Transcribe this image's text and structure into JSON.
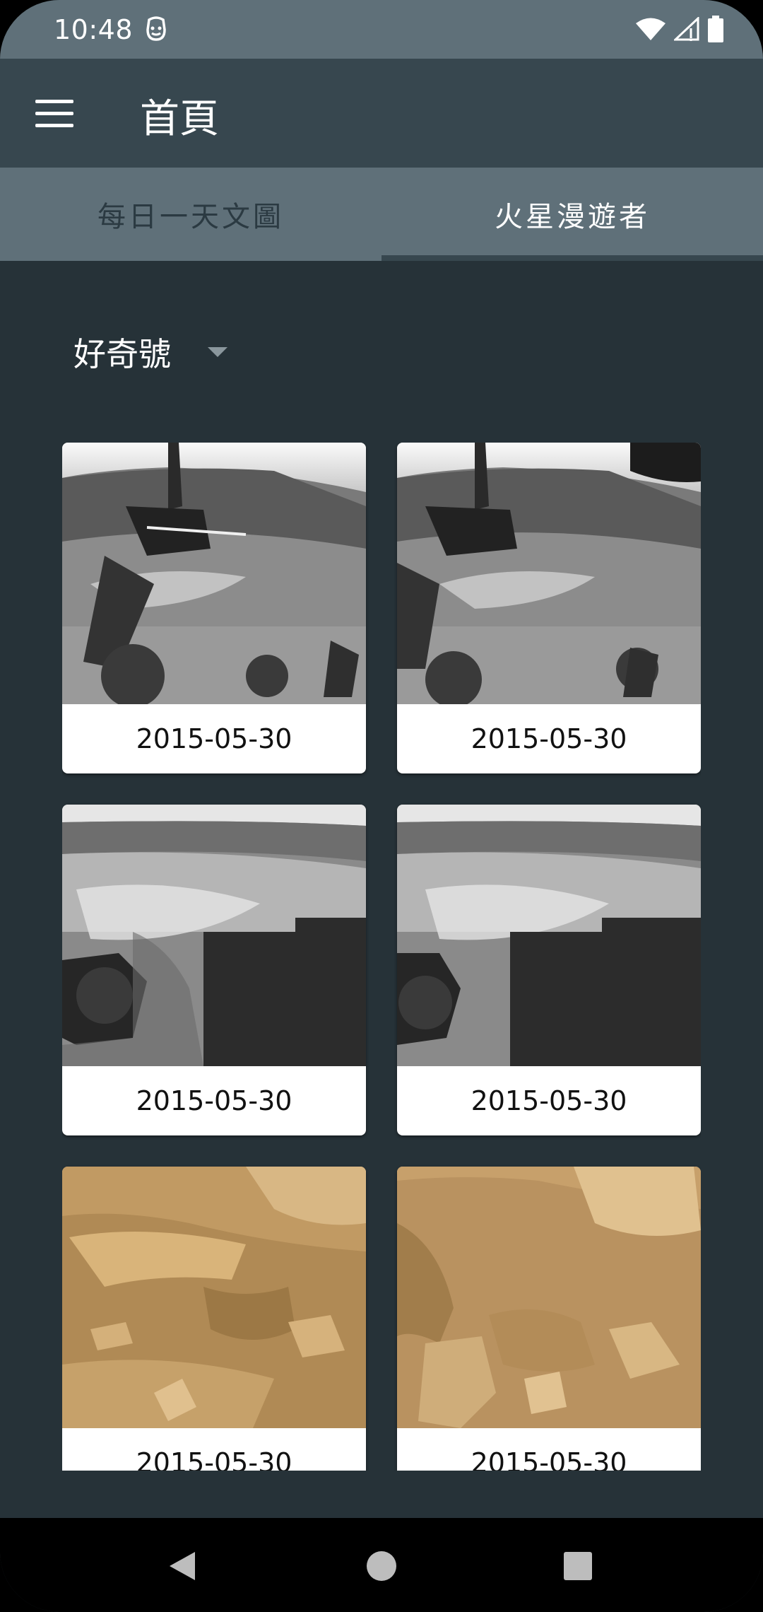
{
  "status_bar": {
    "time": "10:48"
  },
  "app_bar": {
    "title": "首頁",
    "menu_icon": "hamburger-menu-icon"
  },
  "tabs": [
    {
      "label": "每日一天文圖",
      "selected": false
    },
    {
      "label": "火星漫遊者",
      "selected": true
    }
  ],
  "rover_select": {
    "selected": "好奇號",
    "icon": "dropdown-arrow-icon"
  },
  "photos": [
    {
      "date": "2015-05-30",
      "tone": "grayscale"
    },
    {
      "date": "2015-05-30",
      "tone": "grayscale"
    },
    {
      "date": "2015-05-30",
      "tone": "grayscale"
    },
    {
      "date": "2015-05-30",
      "tone": "grayscale"
    },
    {
      "date": "2015-05-30",
      "tone": "color"
    },
    {
      "date": "2015-05-30",
      "tone": "color"
    }
  ],
  "nav_bar": {
    "back_icon": "back-icon",
    "home_icon": "home-icon",
    "recents_icon": "recents-icon"
  }
}
